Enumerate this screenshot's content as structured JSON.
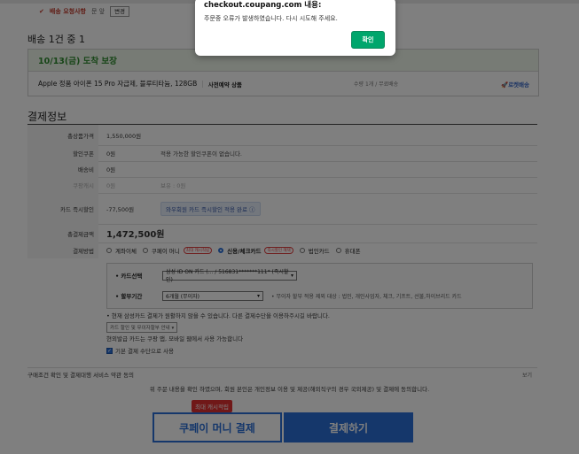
{
  "top": {
    "request_label": "배송 요청사항",
    "request_value": "문 앞",
    "change_button": "변경"
  },
  "shipping": {
    "title": "배송 1건 중 1",
    "guarantee": "10/13(금) 도착 보장",
    "product": "Apple 정품 아이폰 15 Pro 자급제, 블루티타늄, 128GB",
    "presale": "사전예약 상품",
    "qty": "수량 1개 / 무료배송",
    "rocket": "로켓배송"
  },
  "payment": {
    "title": "결제정보",
    "rows": {
      "total": {
        "label": "총상품가격",
        "value": "1,550,000원"
      },
      "coupon": {
        "label": "할인쿠폰",
        "value": "0원",
        "note": "적용 가능한 할인쿠폰이 없습니다."
      },
      "ship_fee": {
        "label": "배송비",
        "value": "0원"
      },
      "cash": {
        "label": "쿠팡캐시",
        "value": "0원",
        "note": "보유 : 0원"
      },
      "card_discount": {
        "label": "카드 즉시할인",
        "value": "-77,500원",
        "badge": "와우회원 카드 즉시할인 적용 완료 ⓘ"
      },
      "final": {
        "label": "총결제금액",
        "value": "1,472,500원"
      }
    },
    "method_label": "결제방법",
    "methods": [
      {
        "label": "계좌이체",
        "tag": ""
      },
      {
        "label": "쿠페이 머니",
        "tag": "최대 캐시적립"
      },
      {
        "label": "신용/체크카드",
        "tag": "즉시할인 혜택"
      },
      {
        "label": "법인카드",
        "tag": ""
      },
      {
        "label": "휴대폰",
        "tag": ""
      }
    ],
    "card_select_label": "카드선택",
    "card_select_value": "삼성 ID ON 카드 (... / 516831*******111* (즉시할인)",
    "installment_label": "할부기간",
    "installment_value": "6개월 (무이자)",
    "installment_hint": "무이자 할부 적용 제외 대상 : 법인, 개인사업자, 체크, 기프트, 선불,하이브리드 카드",
    "warning": "현재 삼성카드 결제가 원활하지 않을 수 있습니다. 다른 결제수단을 이용하주시길 바랍니다.",
    "mini_select": "카드 할인 및 무이자할부 안내",
    "receipt_note": "현외발급 카드는 쿠팡 앱, 모바일 웹에서 사용 가능합니다",
    "default_note": "기본 결제 수단으로 사용"
  },
  "terms": {
    "label": "구매조건 확인 및 결제대행 서비스 약관 동의",
    "view": "보기",
    "agree": "위 주문 내용을 확인 하였으며, 회원 본인은 개인정보 이용 및 제공(해외직구의 경우 국외제공) 및 결제에 동의합니다."
  },
  "buttons": {
    "cashback_tag": "최대 캐시적립",
    "paymoney": "쿠페이 머니 결제",
    "pay": "결제하기"
  },
  "dialog": {
    "title": "checkout.coupang.com 내용:",
    "message": "주문중 오류가 발생하였습니다. 다시 시도해 주세요.",
    "ok": "확인"
  },
  "colors": {
    "accent": "#2b6fd6",
    "ok_button": "#00a66c",
    "discount_red": "#d8201f",
    "guarantee_green": "#2e8b2e"
  }
}
